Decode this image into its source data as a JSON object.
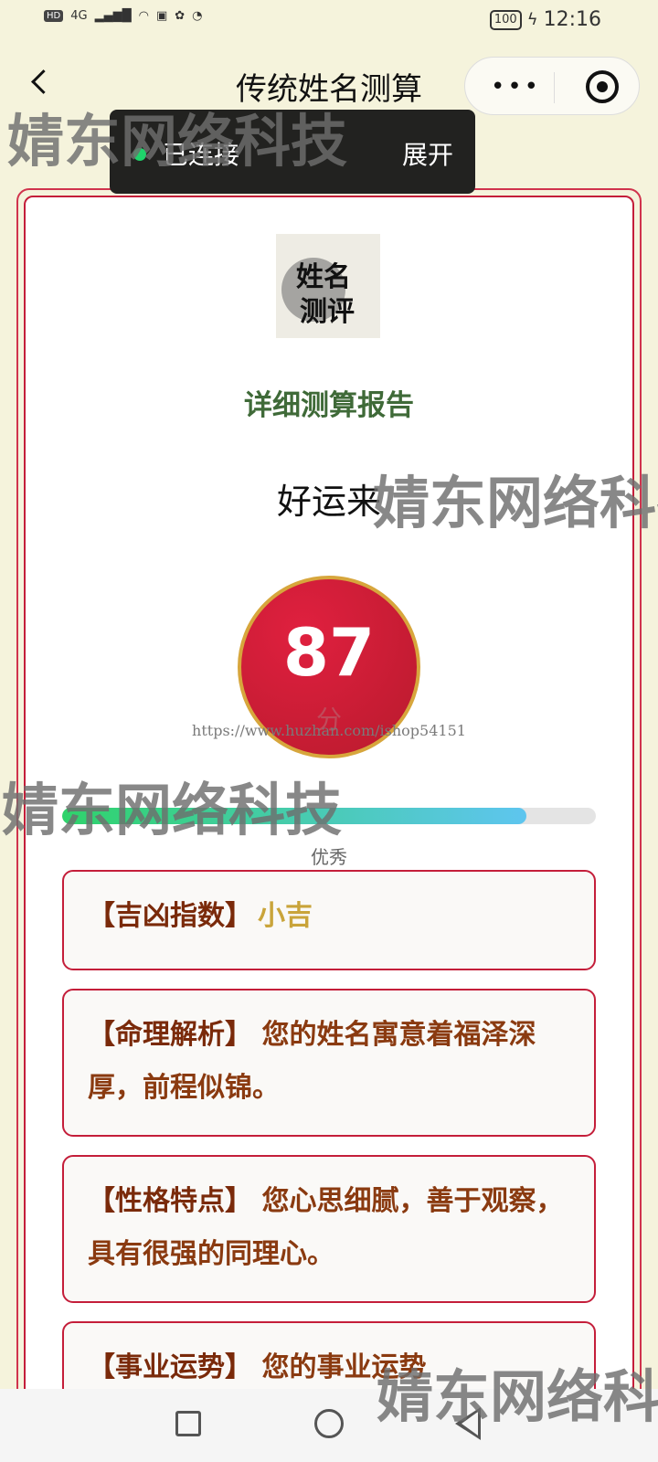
{
  "status_bar": {
    "hd": "HD",
    "network": "4G",
    "battery": "100",
    "time": "12:16"
  },
  "nav": {
    "title": "传统姓名测算",
    "more_icon": "more-dots-icon",
    "target_icon": "target-icon"
  },
  "toast": {
    "status": "已连接",
    "expand": "展开"
  },
  "logo": {
    "line1": "姓名",
    "line2": "测评"
  },
  "report": {
    "title": "详细测算报告",
    "name": "好运来",
    "score": "87",
    "score_unit": "分",
    "progress": 0.87,
    "rating": "优秀"
  },
  "sections": [
    {
      "label": "【吉凶指数】",
      "value": "小吉"
    },
    {
      "label": "【命理解析】",
      "text": "您的姓名寓意着福泽深厚，前程似锦。"
    },
    {
      "label": "【性格特点】",
      "text": "您心思细腻，善于观察，具有很强的同理心。"
    },
    {
      "label": "【事业运势】",
      "text": "您的事业运势"
    }
  ],
  "watermarks": {
    "company": "婧东网络科技",
    "url": "https://www.huzhan.com/ishop54151"
  },
  "colors": {
    "background": "#f5f3dc",
    "accent_red": "#c41e3a",
    "title_green": "#3f6a38",
    "gold": "#d7a63c"
  }
}
